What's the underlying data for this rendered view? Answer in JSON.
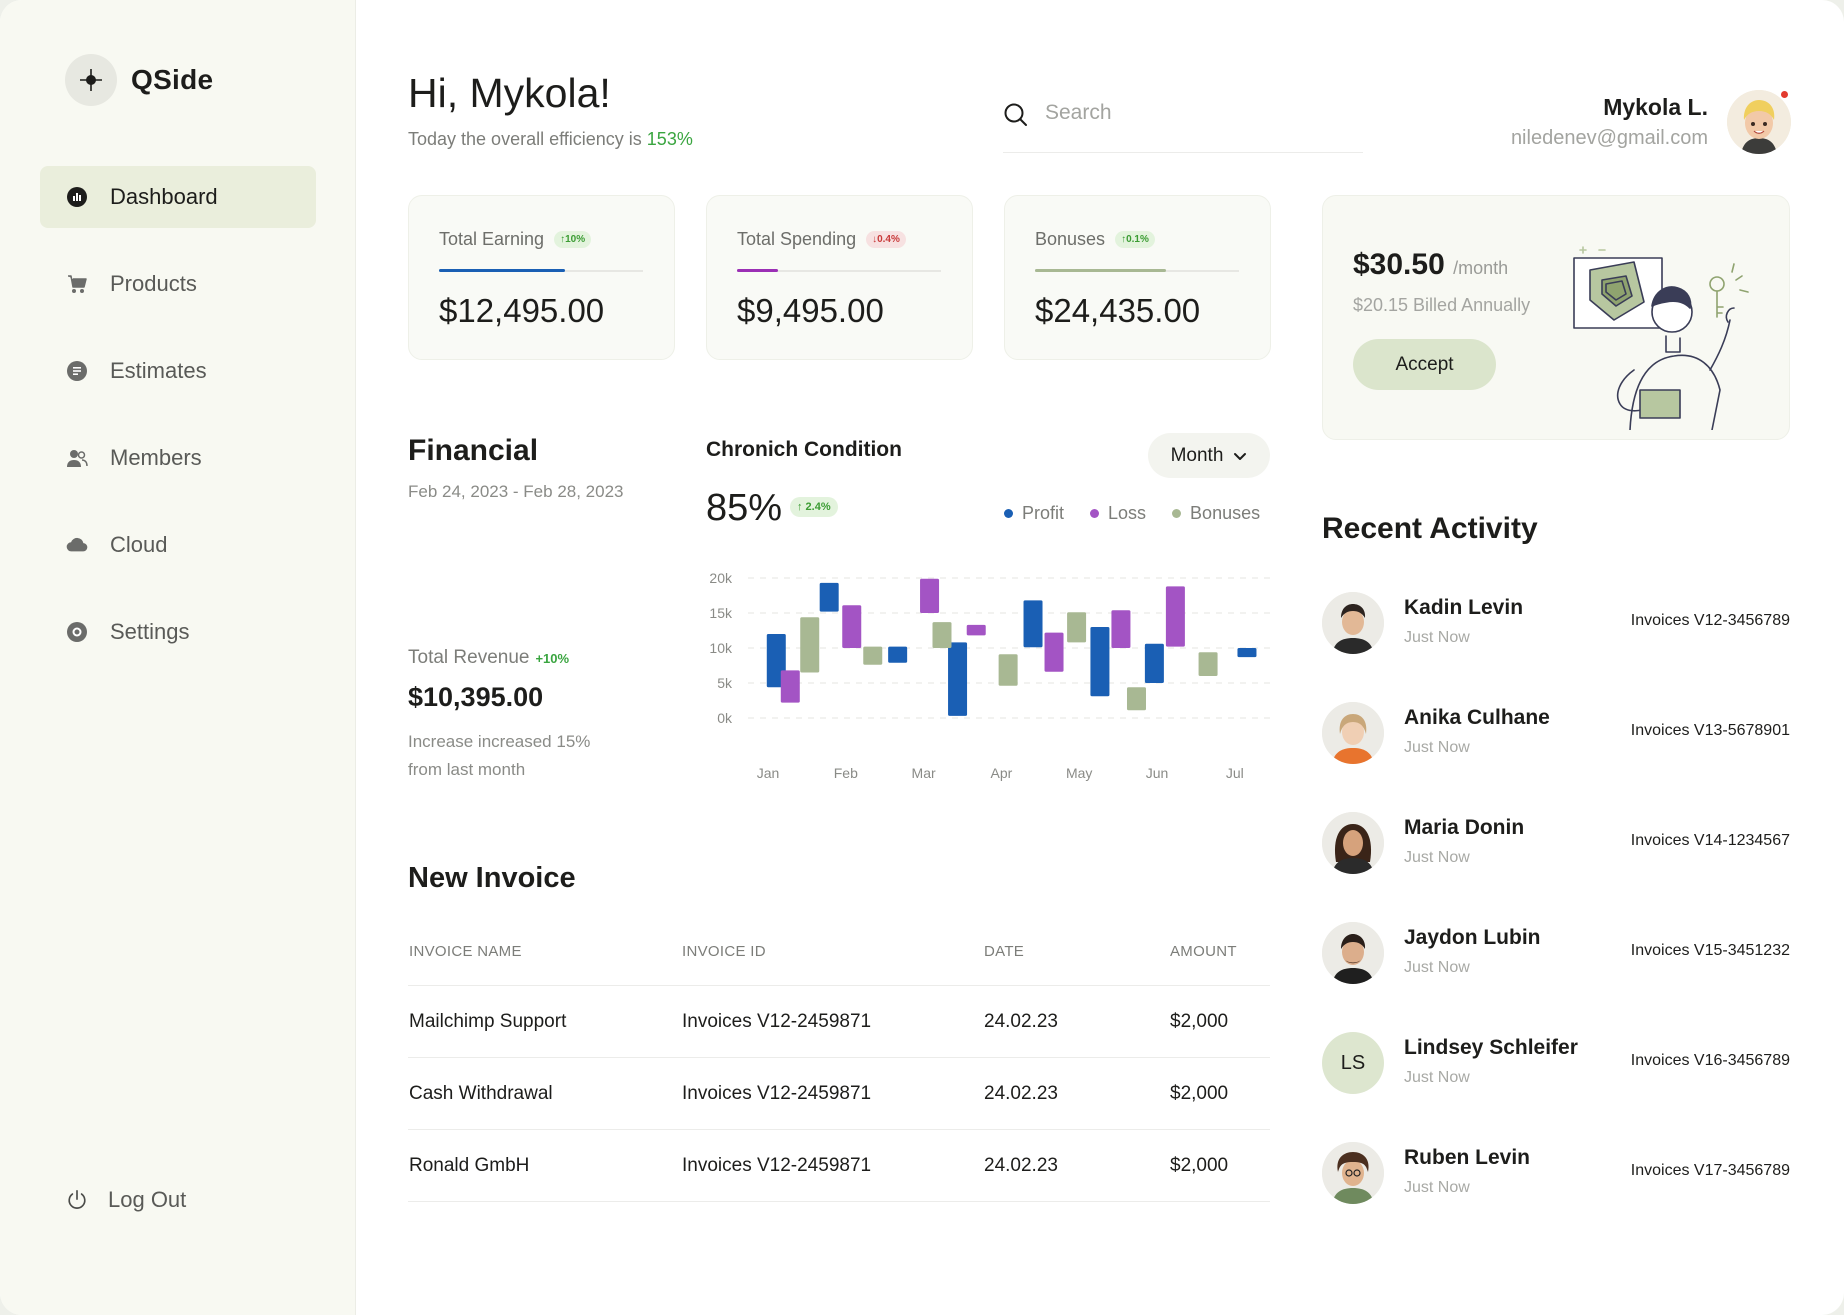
{
  "app": {
    "name": "QSide"
  },
  "colors": {
    "accent": "#eaeedc",
    "profit": "#1a5fb4",
    "loss": "#a354c4",
    "bonuses": "#a8b893",
    "positive": "#3aa540",
    "negative": "#c83a3a"
  },
  "sidebar": {
    "items": [
      {
        "label": "Dashboard",
        "icon": "dashboard-icon",
        "active": true
      },
      {
        "label": "Products",
        "icon": "cart-icon"
      },
      {
        "label": "Estimates",
        "icon": "document-icon"
      },
      {
        "label": "Members",
        "icon": "members-icon"
      },
      {
        "label": "Cloud",
        "icon": "cloud-icon"
      },
      {
        "label": "Settings",
        "icon": "settings-icon"
      }
    ],
    "logout_label": "Log Out"
  },
  "header": {
    "greeting": "Hi, Mykola!",
    "subtitle_prefix": "Today the overall efficiency is ",
    "efficiency": "153%",
    "search_placeholder": "Search",
    "user_name": "Mykola L.",
    "user_email": "niledenev@gmail.com"
  },
  "stats": [
    {
      "label": "Total Earning",
      "badge": "↑10%",
      "trend": "up",
      "value": "$12,495.00",
      "bar_fraction": 0.62,
      "bar_color": "#1a5fb4"
    },
    {
      "label": "Total Spending",
      "badge": "↓0.4%",
      "trend": "down",
      "value": "$9,495.00",
      "bar_fraction": 0.2,
      "bar_color": "#9b2fb5"
    },
    {
      "label": "Bonuses",
      "badge": "↑0.1%",
      "trend": "up",
      "value": "$24,435.00",
      "bar_fraction": 0.64,
      "bar_color": "#a8b893"
    }
  ],
  "promo": {
    "price": "$30.50",
    "per": "/month",
    "billed": "$20.15 Billed Annually",
    "accept_label": "Accept"
  },
  "financial": {
    "title": "Financial",
    "date_range": "Feb 24, 2023 - Feb 28, 2023",
    "revenue_label": "Total Revenue",
    "revenue_badge": "+10%",
    "revenue_value": "$10,395.00",
    "revenue_note": "Increase increased 15% from last month"
  },
  "chart_header": {
    "title": "Chronich Condition",
    "percent": "85%",
    "badge": "↑ 2.4%",
    "period_label": "Month"
  },
  "chart_data": {
    "type": "bar",
    "subtype": "floating-range",
    "title": "Chronich Condition",
    "ylim": [
      0,
      20000
    ],
    "y_ticks": [
      "0k",
      "5k",
      "10k",
      "15k",
      "20k"
    ],
    "x_ticks": [
      "Jan",
      "Feb",
      "Mar",
      "Apr",
      "May",
      "Jun",
      "Jul"
    ],
    "grid": true,
    "legend": "top-right",
    "series": [
      {
        "name": "Profit",
        "color": "#1a5fb4",
        "bars": [
          {
            "x": 0.1,
            "low": 4400,
            "high": 12000
          },
          {
            "x": 0.78,
            "low": 15200,
            "high": 19300
          },
          {
            "x": 1.66,
            "low": 7900,
            "high": 10200
          },
          {
            "x": 2.43,
            "low": 300,
            "high": 10800
          },
          {
            "x": 3.4,
            "low": 10100,
            "high": 16800
          },
          {
            "x": 4.26,
            "low": 3100,
            "high": 13000
          },
          {
            "x": 4.96,
            "low": 5000,
            "high": 10600
          },
          {
            "x": 6.15,
            "low": 8700,
            "high": 10000
          }
        ]
      },
      {
        "name": "Loss",
        "color": "#a354c4",
        "bars": [
          {
            "x": 0.28,
            "low": 2200,
            "high": 6800
          },
          {
            "x": 1.07,
            "low": 10000,
            "high": 16100
          },
          {
            "x": 2.07,
            "low": 15000,
            "high": 19900
          },
          {
            "x": 2.67,
            "low": 11800,
            "high": 13300
          },
          {
            "x": 3.67,
            "low": 6600,
            "high": 12200
          },
          {
            "x": 4.53,
            "low": 10000,
            "high": 15400
          },
          {
            "x": 5.23,
            "low": 10200,
            "high": 18800
          }
        ]
      },
      {
        "name": "Bonuses",
        "color": "#a8b893",
        "bars": [
          {
            "x": 0.53,
            "low": 6500,
            "high": 14400
          },
          {
            "x": 1.34,
            "low": 7600,
            "high": 10200
          },
          {
            "x": 2.23,
            "low": 10000,
            "high": 13700
          },
          {
            "x": 3.08,
            "low": 4600,
            "high": 9100
          },
          {
            "x": 3.96,
            "low": 10800,
            "high": 15100
          },
          {
            "x": 4.73,
            "low": 1100,
            "high": 4400
          },
          {
            "x": 5.65,
            "low": 6000,
            "high": 9400
          }
        ]
      }
    ]
  },
  "invoice": {
    "title": "New Invoice",
    "headers": [
      "INVOICE NAME",
      "INVOICE ID",
      "DATE",
      "AMOUNT"
    ],
    "rows": [
      [
        "Mailchimp Support",
        "Invoices V12-2459871",
        "24.02.23",
        "$2,000"
      ],
      [
        "Cash Withdrawal",
        "Invoices V12-2459871",
        "24.02.23",
        "$2,000"
      ],
      [
        "Ronald GmbH",
        "Invoices V12-2459871",
        "24.02.23",
        "$2,000"
      ]
    ]
  },
  "activity": {
    "title": "Recent Activity",
    "items": [
      {
        "name": "Kadin Levin",
        "time": "Just Now",
        "invoice": "Invoices V12-3456789",
        "avatar": "photo",
        "initials": ""
      },
      {
        "name": "Anika Culhane",
        "time": "Just Now",
        "invoice": "Invoices V13-5678901",
        "avatar": "photo",
        "initials": ""
      },
      {
        "name": "Maria Donin",
        "time": "Just Now",
        "invoice": "Invoices V14-1234567",
        "avatar": "photo",
        "initials": ""
      },
      {
        "name": "Jaydon Lubin",
        "time": "Just Now",
        "invoice": "Invoices V15-3451232",
        "avatar": "photo",
        "initials": ""
      },
      {
        "name": "Lindsey Schleifer",
        "time": "Just Now",
        "invoice": "Invoices V16-3456789",
        "avatar": "initials",
        "initials": "LS"
      },
      {
        "name": "Ruben Levin",
        "time": "Just Now",
        "invoice": "Invoices V17-3456789",
        "avatar": "photo",
        "initials": ""
      }
    ]
  }
}
